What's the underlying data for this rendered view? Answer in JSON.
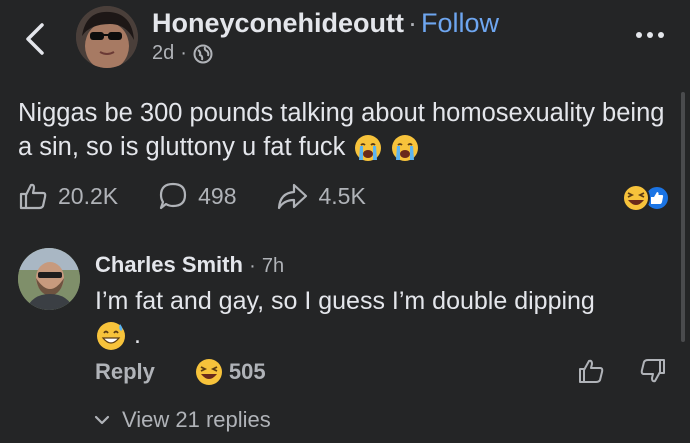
{
  "header": {
    "username": "Honeyconehideoutt",
    "separator": "·",
    "follow_label": "Follow",
    "post_age": "2d",
    "meta_separator": "·",
    "privacy_icon": "globe-icon"
  },
  "post": {
    "text": "Niggas be 300 pounds talking about homosexuality being a sin, so is gluttony u fat fuck",
    "emojis": [
      "loudly-crying-face",
      "loudly-crying-face"
    ]
  },
  "actions": {
    "like_count": "20.2K",
    "comment_count": "498",
    "share_count": "4.5K"
  },
  "reactions": [
    "laughing-face",
    "like-thumb"
  ],
  "comment": {
    "author": "Charles Smith",
    "separator": "·",
    "time": "7h",
    "text": "I’m fat and gay, so I guess I’m double dipping",
    "trailing": ".",
    "emoji": "grinning-sweat-face",
    "reply_label": "Reply",
    "reaction_count": "505",
    "view_replies_label": "View 21 replies"
  },
  "colors": {
    "background": "#242526",
    "text": "#e4e6eb",
    "muted": "#b0b3b8",
    "link": "#6ea6f0"
  }
}
